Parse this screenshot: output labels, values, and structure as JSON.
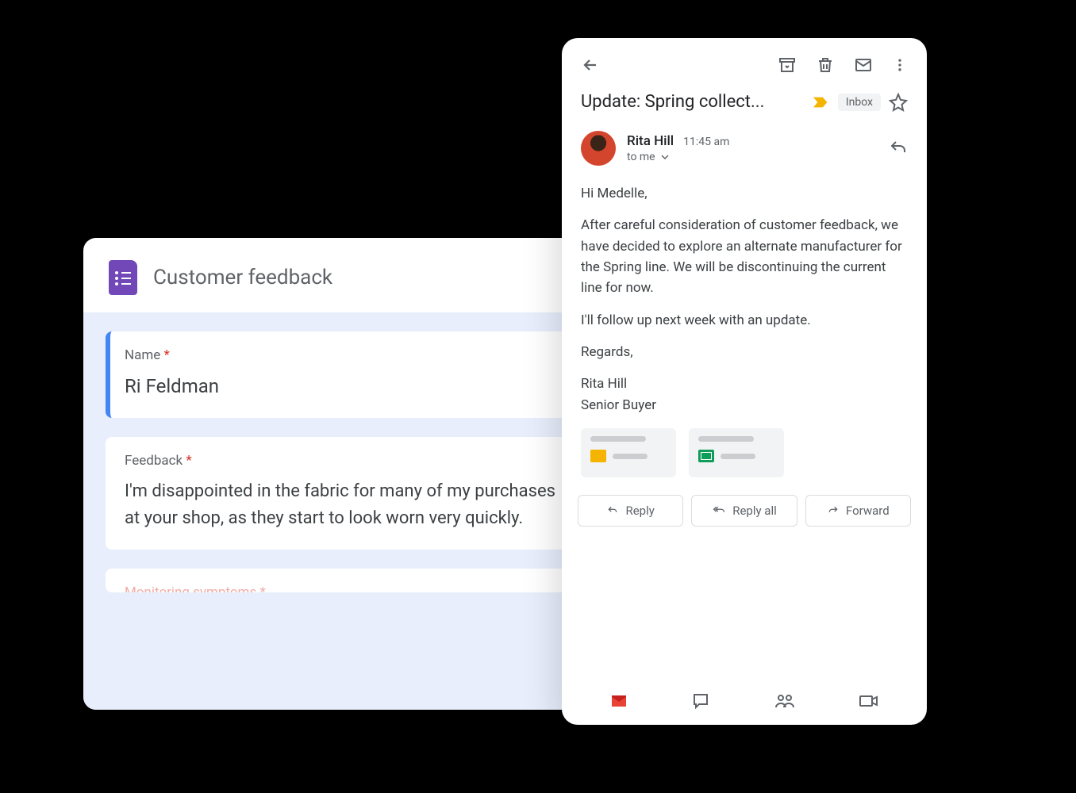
{
  "forms": {
    "title": "Customer feedback",
    "fields": [
      {
        "label": "Name",
        "required": true,
        "value": "Ri Feldman"
      },
      {
        "label": "Feedback",
        "required": true,
        "value": "I'm disappointed in the fabric for many of my purchases at your shop, as they start to look worn very quickly."
      },
      {
        "label": "Monitoring symptoms",
        "required": true,
        "value": ""
      }
    ]
  },
  "gmail": {
    "subject": "Update: Spring collect...",
    "inbox_label": "Inbox",
    "sender": {
      "name": "Rita Hill",
      "time": "11:45 am",
      "to": "to me"
    },
    "body": {
      "greeting": "Hi Medelle,",
      "p1": "After careful consideration of customer feedback, we have decided to explore an alternate manufacturer for the Spring line. We will be discontinuing the current line for now.",
      "p2": "I'll follow up next week with an update.",
      "closing": "Regards,",
      "sig_name": "Rita Hill",
      "sig_title": "Senior Buyer"
    },
    "actions": {
      "reply": "Reply",
      "reply_all": "Reply all",
      "forward": "Forward"
    }
  }
}
